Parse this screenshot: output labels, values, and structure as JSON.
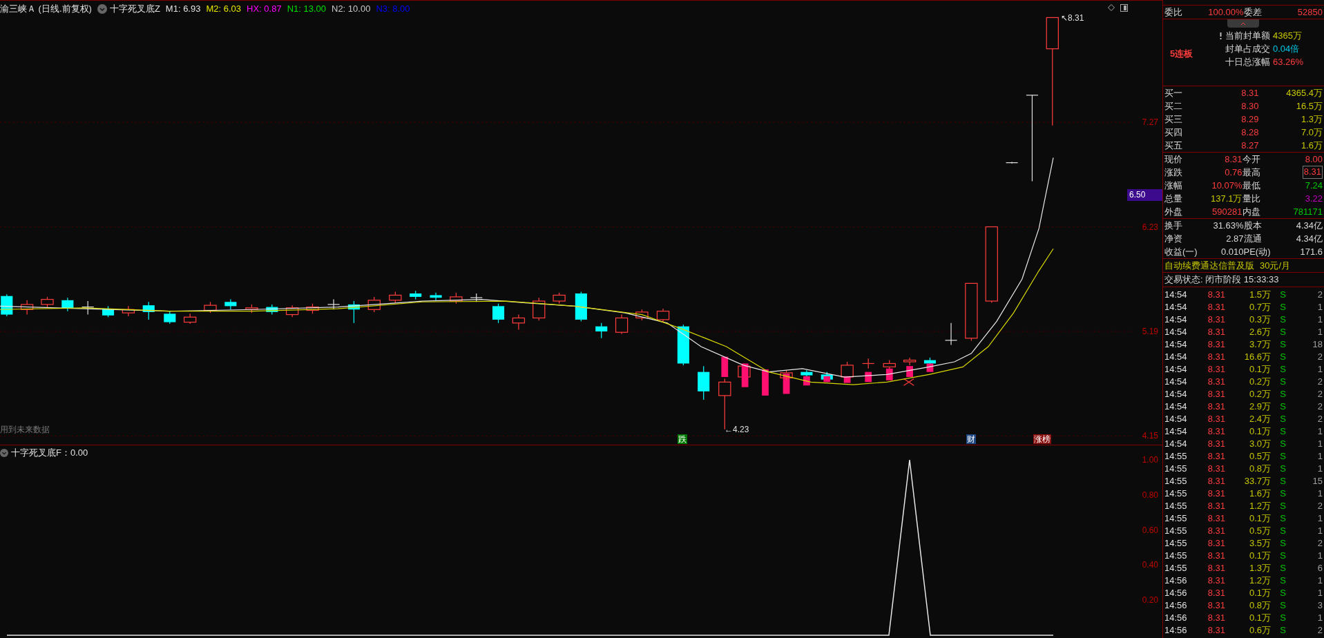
{
  "chart_header": {
    "title": "渝三峡Ａ (日线.前复权)",
    "indicator": "十字死叉底Z",
    "params": [
      {
        "text": "M1: 6.93",
        "color": "#e0e0e0"
      },
      {
        "text": "M2: 6.03",
        "color": "#e6e600"
      },
      {
        "text": "HX: 0.87",
        "color": "#ff00ff"
      },
      {
        "text": "N1: 13.00",
        "color": "#00e000"
      },
      {
        "text": "N2: 10.00",
        "color": "#c8c8c8"
      },
      {
        "text": "N3: 8.00",
        "color": "#0000ff"
      }
    ]
  },
  "main_chart": {
    "axis_labels": [
      "7.27",
      "6.23",
      "5.19",
      "4.15"
    ],
    "price_tag": "6.50",
    "high_label": "↖8.31",
    "low_label": "←4.23",
    "note": "用到未来数据",
    "markers": [
      {
        "text": "跌",
        "color": "#007a00"
      },
      {
        "text": "财",
        "color": "#1e4682"
      },
      {
        "text": "涨榜",
        "color": "#8a1010"
      }
    ]
  },
  "indicator_panel": {
    "title": "十字死叉底F：0.00",
    "axis_labels": [
      "1.00",
      "0.80",
      "0.60",
      "0.40",
      "0.20"
    ]
  },
  "summary": [
    {
      "label": "委比",
      "value": "100.00%"
    },
    {
      "label": "委差",
      "value": "52850"
    }
  ],
  "limit_info": {
    "streak": "5连板",
    "rows": [
      {
        "label": "当前封单额",
        "value": "4365万",
        "kind": "volume",
        "flagged": true
      },
      {
        "label": "封单占成交",
        "value": "0.04倍",
        "kind": "multiple",
        "flagged": false
      },
      {
        "label": "十日总涨幅",
        "value": "63.26%",
        "kind": "up",
        "flagged": false
      }
    ]
  },
  "bids": [
    {
      "label": "买一",
      "price": "8.31",
      "volume": "4365.4万"
    },
    {
      "label": "买二",
      "price": "8.30",
      "volume": "16.5万"
    },
    {
      "label": "买三",
      "price": "8.29",
      "volume": "1.3万"
    },
    {
      "label": "买四",
      "price": "8.28",
      "volume": "7.0万"
    },
    {
      "label": "买五",
      "price": "8.27",
      "volume": "1.6万"
    }
  ],
  "quote": [
    {
      "label": "现价",
      "value": "8.31",
      "kind": "up",
      "highlighted": false
    },
    {
      "label": "今开",
      "value": "8.00",
      "kind": "up",
      "highlighted": false
    },
    {
      "label": "涨跌",
      "value": "0.76",
      "kind": "up",
      "highlighted": false
    },
    {
      "label": "最高",
      "value": "8.31",
      "kind": "up",
      "highlighted": true
    },
    {
      "label": "涨幅",
      "value": "10.07%",
      "kind": "up",
      "highlighted": false
    },
    {
      "label": "最低",
      "value": "7.24",
      "kind": "down",
      "highlighted": false
    },
    {
      "label": "总量",
      "value": "137.1万",
      "kind": "volume",
      "highlighted": false
    },
    {
      "label": "量比",
      "value": "3.22",
      "kind": "ratio",
      "highlighted": false
    },
    {
      "label": "外盘",
      "value": "590281",
      "kind": "up",
      "highlighted": false
    },
    {
      "label": "内盘",
      "value": "781171",
      "kind": "down",
      "highlighted": false
    }
  ],
  "fundamentals": [
    {
      "label": "换手",
      "value": "31.63%"
    },
    {
      "label": "股本",
      "value": "4.34亿"
    },
    {
      "label": "净资",
      "value": "2.87"
    },
    {
      "label": "流通",
      "value": "4.34亿"
    },
    {
      "label": "收益(一)",
      "value": "0.010"
    },
    {
      "label": "PE(动)",
      "value": "171.6"
    }
  ],
  "promo": {
    "text": "自动续费通达信普及版",
    "price": "30元/月"
  },
  "trade_status": "交易状态: 闭市阶段 15:33:33",
  "trades": [
    {
      "time": "14:54",
      "price": "8.31",
      "volume": "1.5万",
      "side": "S",
      "count": "2",
      "kind": "sell"
    },
    {
      "time": "14:54",
      "price": "8.31",
      "volume": "0.7万",
      "side": "S",
      "count": "1",
      "kind": "sell"
    },
    {
      "time": "14:54",
      "price": "8.31",
      "volume": "0.3万",
      "side": "S",
      "count": "1",
      "kind": "sell"
    },
    {
      "time": "14:54",
      "price": "8.31",
      "volume": "2.6万",
      "side": "S",
      "count": "1",
      "kind": "sell"
    },
    {
      "time": "14:54",
      "price": "8.31",
      "volume": "3.7万",
      "side": "S",
      "count": "18",
      "kind": "sell"
    },
    {
      "time": "14:54",
      "price": "8.31",
      "volume": "16.6万",
      "side": "S",
      "count": "2",
      "kind": "sell"
    },
    {
      "time": "14:54",
      "price": "8.31",
      "volume": "0.1万",
      "side": "S",
      "count": "1",
      "kind": "sell"
    },
    {
      "time": "14:54",
      "price": "8.31",
      "volume": "0.2万",
      "side": "S",
      "count": "2",
      "kind": "sell"
    },
    {
      "time": "14:54",
      "price": "8.31",
      "volume": "0.2万",
      "side": "S",
      "count": "2",
      "kind": "sell"
    },
    {
      "time": "14:54",
      "price": "8.31",
      "volume": "2.9万",
      "side": "S",
      "count": "2",
      "kind": "sell"
    },
    {
      "time": "14:54",
      "price": "8.31",
      "volume": "2.4万",
      "side": "S",
      "count": "2",
      "kind": "sell"
    },
    {
      "time": "14:54",
      "price": "8.31",
      "volume": "0.1万",
      "side": "S",
      "count": "1",
      "kind": "sell"
    },
    {
      "time": "14:54",
      "price": "8.31",
      "volume": "3.0万",
      "side": "S",
      "count": "1",
      "kind": "sell"
    },
    {
      "time": "14:55",
      "price": "8.31",
      "volume": "0.5万",
      "side": "S",
      "count": "1",
      "kind": "sell"
    },
    {
      "time": "14:55",
      "price": "8.31",
      "volume": "0.8万",
      "side": "S",
      "count": "1",
      "kind": "sell"
    },
    {
      "time": "14:55",
      "price": "8.31",
      "volume": "33.7万",
      "side": "S",
      "count": "15",
      "kind": "sell"
    },
    {
      "time": "14:55",
      "price": "8.31",
      "volume": "1.6万",
      "side": "S",
      "count": "1",
      "kind": "sell"
    },
    {
      "time": "14:55",
      "price": "8.31",
      "volume": "1.2万",
      "side": "S",
      "count": "2",
      "kind": "sell"
    },
    {
      "time": "14:55",
      "price": "8.31",
      "volume": "0.1万",
      "side": "S",
      "count": "1",
      "kind": "sell"
    },
    {
      "time": "14:55",
      "price": "8.31",
      "volume": "0.5万",
      "side": "S",
      "count": "1",
      "kind": "sell"
    },
    {
      "time": "14:55",
      "price": "8.31",
      "volume": "3.5万",
      "side": "S",
      "count": "2",
      "kind": "sell"
    },
    {
      "time": "14:55",
      "price": "8.31",
      "volume": "0.1万",
      "side": "S",
      "count": "1",
      "kind": "sell"
    },
    {
      "time": "14:55",
      "price": "8.31",
      "volume": "1.3万",
      "side": "S",
      "count": "6",
      "kind": "sell"
    },
    {
      "time": "14:56",
      "price": "8.31",
      "volume": "1.2万",
      "side": "S",
      "count": "1",
      "kind": "sell"
    },
    {
      "time": "14:56",
      "price": "8.31",
      "volume": "0.1万",
      "side": "S",
      "count": "1",
      "kind": "sell"
    },
    {
      "time": "14:56",
      "price": "8.31",
      "volume": "0.8万",
      "side": "S",
      "count": "3",
      "kind": "sell"
    },
    {
      "time": "14:56",
      "price": "8.31",
      "volume": "0.1万",
      "side": "S",
      "count": "1",
      "kind": "sell"
    },
    {
      "time": "14:56",
      "price": "8.31",
      "volume": "0.6万",
      "side": "S",
      "count": "2",
      "kind": "sell"
    }
  ]
}
